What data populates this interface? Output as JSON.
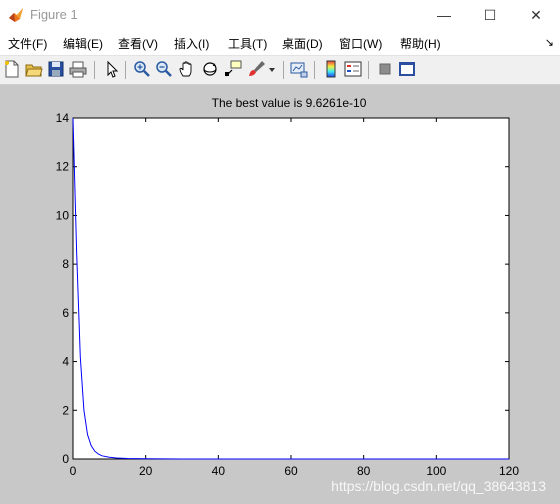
{
  "window": {
    "title": "Figure 1",
    "icon": "matlab-icon",
    "controls": [
      {
        "name": "minimize-button",
        "glyph": "—"
      },
      {
        "name": "maximize-button",
        "glyph": "☐"
      },
      {
        "name": "close-button",
        "glyph": "✕"
      }
    ]
  },
  "menu": {
    "items": [
      "文件(F)",
      "编辑(E)",
      "查看(V)",
      "插入(I)",
      "工具(T)",
      "桌面(D)",
      "窗口(W)",
      "帮助(H)"
    ],
    "dock_arrow": "↘"
  },
  "toolbar": {
    "buttons": [
      "new-figure-icon",
      "open-file-icon",
      "save-icon",
      "print-icon",
      "edit-plot-icon",
      "zoom-in-icon",
      "zoom-out-icon",
      "pan-icon",
      "rotate-3d-icon",
      "data-cursor-icon",
      "brush-icon",
      "link-plot-icon",
      "colorbar-icon",
      "legend-icon",
      "hide-plot-tools-icon",
      "show-plot-tools-icon"
    ]
  },
  "chart_data": {
    "type": "line",
    "title": "The best value is 9.6261e-10",
    "xlim": [
      0,
      120
    ],
    "ylim": [
      0,
      14
    ],
    "xticks": [
      0,
      20,
      40,
      60,
      80,
      100,
      120
    ],
    "yticks": [
      0,
      2,
      4,
      6,
      8,
      10,
      12,
      14
    ],
    "grid": false,
    "series": [
      {
        "color": "#0000ff",
        "x": [
          0,
          1,
          2,
          3,
          4,
          5,
          6,
          7,
          8,
          10,
          12,
          15,
          20,
          30,
          40,
          60,
          80,
          100,
          120
        ],
        "y": [
          14,
          8.5,
          4.2,
          2.0,
          1.0,
          0.55,
          0.32,
          0.2,
          0.13,
          0.07,
          0.04,
          0.02,
          0.008,
          0.001,
          0.0002,
          0,
          0,
          0,
          0
        ]
      }
    ]
  },
  "watermark": "https://blog.csdn.net/qq_38643813"
}
